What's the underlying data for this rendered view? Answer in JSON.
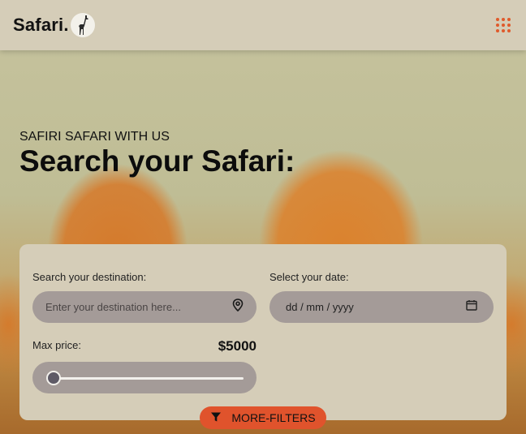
{
  "header": {
    "logo_text": "Safari.",
    "logo_icon": "giraffe-icon",
    "menu_icon": "grid-menu-icon"
  },
  "hero": {
    "eyebrow": "SAFIRI SAFARI WITH US",
    "title": "Search your Safari:"
  },
  "search_panel": {
    "destination_label": "Search your destination:",
    "destination_placeholder": "Enter your destination here...",
    "destination_icon": "location-pin-icon",
    "date_label": "Select your date:",
    "date_placeholder": "dd / mm / yyyy",
    "date_icon": "calendar-icon",
    "price_label": "Max price:",
    "price_value": "$5000",
    "price_slider_fraction": 0
  },
  "more_filters": {
    "label": "MORE-FILTERS",
    "icon": "filter-funnel-icon"
  },
  "colors": {
    "accent": "#e0532c",
    "panel": "#d5cdb8",
    "field": "#a49b98"
  }
}
